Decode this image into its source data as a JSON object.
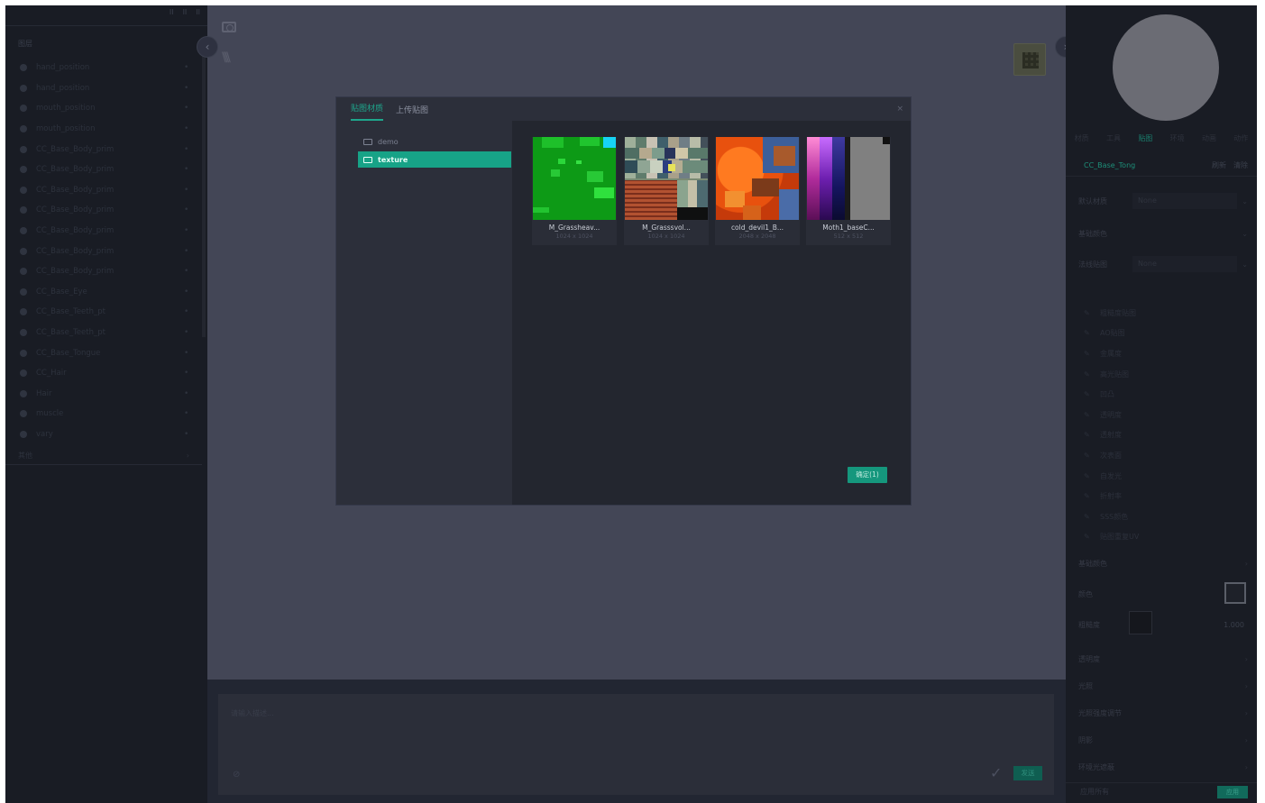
{
  "left": {
    "top_controls": [
      "II",
      "II",
      "II"
    ],
    "header": "图层",
    "layers": [
      "hand_position",
      "hand_position",
      "mouth_position",
      "mouth_position",
      "CC_Base_Body_prim",
      "CC_Base_Body_prim",
      "CC_Base_Body_prim",
      "CC_Base_Body_prim",
      "CC_Base_Body_prim",
      "CC_Base_Body_prim",
      "CC_Base_Body_prim",
      "CC_Base_Eye",
      "CC_Base_Teeth_pt",
      "CC_Base_Teeth_pt",
      "CC_Base_Tongue",
      "CC_Hair",
      "Hair",
      "muscle",
      "vary"
    ],
    "footer": "其他"
  },
  "modal": {
    "tabs": [
      "贴图材质",
      "上传贴图"
    ],
    "close": "×",
    "folders": [
      {
        "label": "demo",
        "selected": false
      },
      {
        "label": "texture",
        "selected": true
      }
    ],
    "items": [
      {
        "name": "M_Grassheav...",
        "size": "1024 x 1024"
      },
      {
        "name": "M_Grasssvol...",
        "size": "1024 x 1024"
      },
      {
        "name": "cold_devil1_B...",
        "size": "2048 x 2048"
      },
      {
        "name": "Moth1_baseC...",
        "size": "512 x 512"
      }
    ],
    "confirm_label": "确定(1)"
  },
  "prompt": {
    "placeholder": "请输入描述...",
    "send_label": "发送"
  },
  "right": {
    "tabs": [
      "材质",
      "工具",
      "贴图",
      "环境",
      "动画",
      "动作"
    ],
    "active_tab": "贴图",
    "model": "CC_Base_Tong",
    "actions": [
      "刷新",
      "清除"
    ],
    "prop_rows": [
      {
        "label": "默认材质",
        "value": "None"
      },
      {
        "label": "基础颜色",
        "value": ""
      },
      {
        "label": "法线贴图",
        "value": "None"
      }
    ],
    "checks": [
      "粗糙度贴图",
      "AO贴图",
      "金属度",
      "高光贴图",
      "凹凸",
      "透明度",
      "透射度",
      "次表面",
      "自发光",
      "折射率",
      "SSS颜色",
      "贴图重复UV"
    ],
    "settings": [
      "基础颜色",
      "颜色",
      "粗糙度",
      "透明度",
      "光照",
      "光照强度调节",
      "阴影",
      "环境光遮蔽"
    ],
    "color_value": "1.000",
    "apply_row_label": "应用所有",
    "apply_label": "应用"
  },
  "colors": {
    "accent": "#17a387",
    "app_bg": "#222632",
    "viewport_bg": "#434656",
    "modal_bg": "#2c2f3a"
  }
}
